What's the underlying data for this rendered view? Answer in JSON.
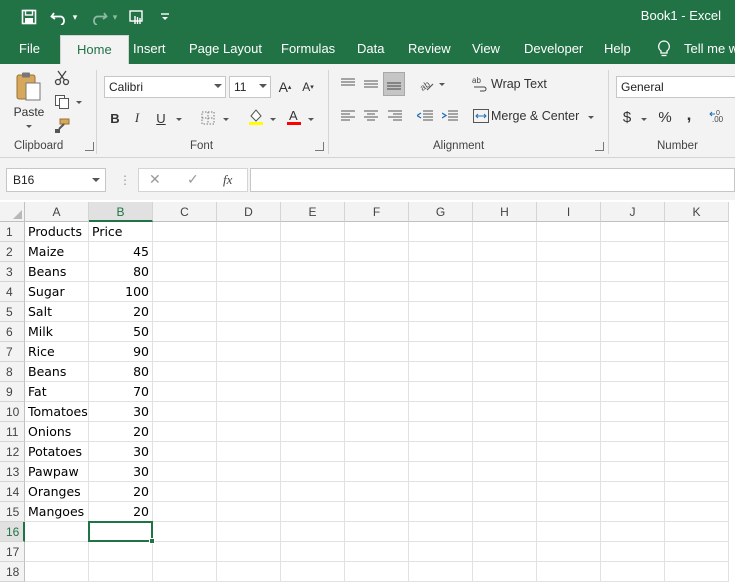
{
  "window": {
    "title": "Book1  -  Excel"
  },
  "qat": {
    "save": "save-icon",
    "undo": "undo-icon",
    "redo": "redo-icon",
    "touch": "touch-mode-icon",
    "customize": "customize-icon"
  },
  "tabs": [
    "File",
    "Home",
    "Insert",
    "Page Layout",
    "Formulas",
    "Data",
    "Review",
    "View",
    "Developer",
    "Help"
  ],
  "tell_me": "Tell me w",
  "ribbon": {
    "clipboard": {
      "paste_label": "Paste",
      "group_label": "Clipboard"
    },
    "font": {
      "name": "Calibri",
      "size": "11",
      "group_label": "Font",
      "bold": "B",
      "italic": "I",
      "underline": "U"
    },
    "alignment": {
      "wrap_text": "Wrap Text",
      "merge_center": "Merge & Center",
      "group_label": "Alignment"
    },
    "number": {
      "format": "General",
      "currency": "$",
      "percent": "%",
      "comma": ",",
      "group_label": "Number"
    }
  },
  "formula_bar": {
    "name_box": "B16",
    "cancel": "✕",
    "enter": "✓",
    "fx": "fx",
    "formula": ""
  },
  "sheet": {
    "columns": [
      "A",
      "B",
      "C",
      "D",
      "E",
      "F",
      "G",
      "H",
      "I",
      "J",
      "K"
    ],
    "row_numbers": [
      "1",
      "2",
      "3",
      "4",
      "5",
      "6",
      "7",
      "8",
      "9",
      "10",
      "11",
      "12",
      "13",
      "14",
      "15",
      "16",
      "17",
      "18"
    ],
    "selected_cell": "B16",
    "rows": [
      [
        "Products",
        "Price"
      ],
      [
        "Maize",
        "45"
      ],
      [
        "Beans",
        "80"
      ],
      [
        "Sugar",
        "100"
      ],
      [
        "Salt",
        "20"
      ],
      [
        "Milk",
        "50"
      ],
      [
        "Rice",
        "90"
      ],
      [
        "Beans",
        "80"
      ],
      [
        "Fat",
        "70"
      ],
      [
        "Tomatoes",
        "30"
      ],
      [
        "Onions",
        "20"
      ],
      [
        "Potatoes",
        "30"
      ],
      [
        "Pawpaw",
        "30"
      ],
      [
        "Oranges",
        "20"
      ],
      [
        "Mangoes",
        "20"
      ]
    ]
  },
  "colors": {
    "accent": "#217346",
    "ribbon_bg": "#f3f3f3",
    "gridline": "#e1e1e1",
    "font_color_bar": "#ff0000",
    "highlight_bar": "#ffff00"
  }
}
